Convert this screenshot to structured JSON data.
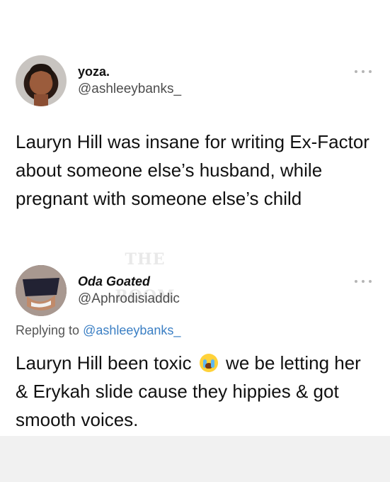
{
  "tweet1": {
    "display_name": "yoza.",
    "handle": "@ashleeybanks_",
    "text": "Lauryn Hill was insane for writing Ex-Factor about someone else’s husband, while pregnant with someone else’s child"
  },
  "tweet2": {
    "display_name": "Oda Goated",
    "handle": "@Aphrodisiaddic",
    "replying_prefix": "Replying to",
    "replying_handle": "@ashleeybanks_",
    "text_part1": "Lauryn Hill been toxic",
    "emoji": "loudly-crying-face-emoji",
    "text_part2": "we be letting her & Erykah slide cause they hippies & got smooth voices."
  },
  "watermark": {
    "line1": "THE",
    "line2": "ROOM"
  },
  "colors": {
    "link": "#3b7fc4",
    "handle_gray": "#4d4d4d",
    "background": "#ffffff"
  }
}
